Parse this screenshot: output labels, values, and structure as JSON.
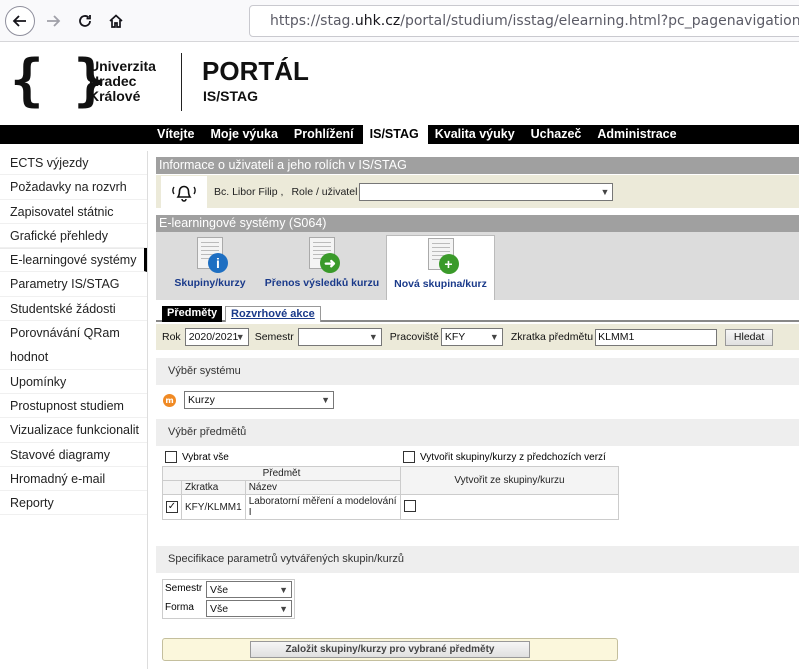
{
  "browser": {
    "url_prefix": "https://stag.",
    "url_domain": "uhk.cz",
    "url_rest": "/portal/studium/isstag/elearning.html?pc_pagenavigationalsta"
  },
  "header": {
    "logo_line1": "Univerzita",
    "logo_line2": "Hradec",
    "logo_line3": "Králové",
    "portal_title": "PORTÁL",
    "portal_sub": "IS/STAG"
  },
  "topmenu": [
    "Vítejte",
    "Moje výuka",
    "Prohlížení",
    "IS/STAG",
    "Kvalita výuky",
    "Uchazeč",
    "Administrace"
  ],
  "topmenu_active": "IS/STAG",
  "sidebar": {
    "items": [
      "ECTS výjezdy",
      "Požadavky na rozvrh",
      "Zapisovatel státnic",
      "Grafické přehledy",
      "E-learningové systémy",
      "Parametry IS/STAG",
      "Studentské žádosti",
      "Porovnávání QRam",
      "hodnot",
      "Upomínky",
      "Prostupnost studiem",
      "Vizualizace funkcionalit",
      "Stavové diagramy",
      "Hromadný e-mail",
      "Reporty"
    ],
    "active": "E-learningové systémy"
  },
  "userinfo": {
    "title": "Informace o uživateli a jeho rolích v IS/STAG",
    "user_name": "Bc. Libor Filip ,",
    "role_label": "Role / uživatel",
    "role_value": ""
  },
  "elearning": {
    "title": "E-learningové systémy (S064)",
    "tabs": [
      {
        "label": "Skupiny/kurzy",
        "icon": "info-icon",
        "color": "#1e6fc2"
      },
      {
        "label": "Přenos výsledků kurzu",
        "icon": "arrow-right-icon",
        "color": "#3a9a2a"
      },
      {
        "label": "Nová skupina/kurz",
        "icon": "plus-icon",
        "color": "#3a9a2a"
      }
    ],
    "subtabs": [
      "Předměty",
      "Rozvrhové akce"
    ]
  },
  "filters": {
    "rok_label": "Rok",
    "rok_value": "2020/2021",
    "semestr_label": "Semestr",
    "semestr_value": "",
    "pracoviste_label": "Pracoviště",
    "pracoviste_value": "KFY",
    "zkratka_label": "Zkratka předmětu",
    "zkratka_value": "KLMM1",
    "search_button": "Hledat"
  },
  "system": {
    "title": "Výběr systému",
    "value": "Kurzy"
  },
  "subjects": {
    "title": "Výběr předmětů",
    "select_all": "Vybrat vše",
    "create_from_prev": "Vytvořit skupiny/kurzy z předchozích verzí",
    "col_predmet": "Předmět",
    "col_create_from": "Vytvořit ze skupiny/kurzu",
    "col_zkratka": "Zkratka",
    "col_nazev": "Název",
    "rows": [
      {
        "zkratka": "KFY/KLMM1",
        "nazev": "Laboratorní měření a modelování I",
        "checked": true
      }
    ]
  },
  "spec": {
    "title": "Specifikace parametrů vytvářených skupin/kurzů",
    "semestr_label": "Semestr",
    "semestr_value": "Vše",
    "forma_label": "Forma",
    "forma_value": "Vše",
    "submit": "Založit skupiny/kurzy pro vybrané předměty"
  }
}
